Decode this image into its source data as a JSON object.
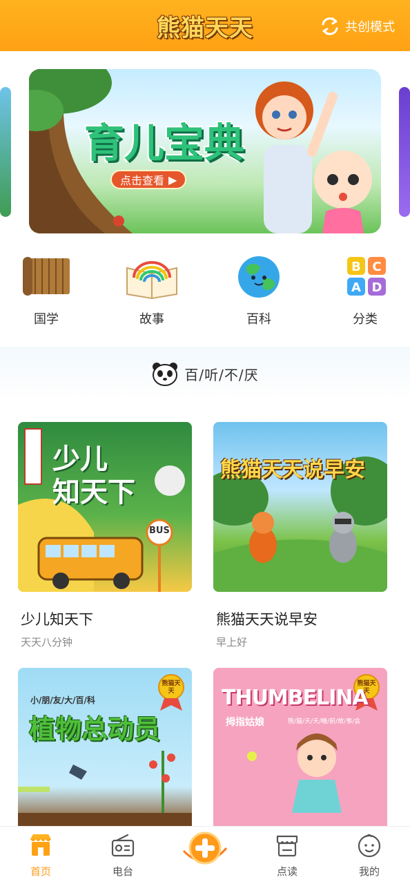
{
  "header": {
    "logo_text": "熊猫天天",
    "mode_label": "共创模式",
    "bg_color": "#ffa114"
  },
  "banner": {
    "title": "育儿宝典",
    "button_label": "点击查看"
  },
  "categories": [
    {
      "label": "国学",
      "icon": "bamboo-scroll-icon"
    },
    {
      "label": "故事",
      "icon": "rainbow-book-icon"
    },
    {
      "label": "百科",
      "icon": "earth-globe-icon"
    },
    {
      "label": "分类",
      "icon": "abcd-blocks-icon"
    }
  ],
  "section": {
    "title": "百/听/不/厌",
    "icon": "panda-face-icon"
  },
  "albums": [
    {
      "name": "少儿知天下",
      "subtitle": "天天八分钟",
      "cover_text": "少儿\n知天下",
      "cover_badge": "BUS"
    },
    {
      "name": "熊猫天天说早安",
      "subtitle": "早上好",
      "cover_text": "熊猫天天说早安"
    },
    {
      "name": "",
      "subtitle": "",
      "cover_text": "植物总动员",
      "cover_small": "小/朋/友/大/百/科",
      "cover_medal": "熊猫天天"
    },
    {
      "name": "",
      "subtitle": "",
      "cover_text": "THUMBELINA",
      "cover_small": "拇指姑娘",
      "cover_tag": "熊/猫/天/天/睡/前/故/事/会",
      "cover_medal": "熊猫天天"
    }
  ],
  "tabbar": {
    "items": [
      {
        "label": "首页",
        "icon": "home-shop-icon",
        "active": true
      },
      {
        "label": "电台",
        "icon": "radio-icon",
        "active": false
      },
      {
        "label": "",
        "icon": "plus-create-icon",
        "active": false
      },
      {
        "label": "点读",
        "icon": "store-reading-icon",
        "active": false
      },
      {
        "label": "我的",
        "icon": "baby-face-icon",
        "active": false
      }
    ],
    "active_color": "#ff9a1a"
  }
}
